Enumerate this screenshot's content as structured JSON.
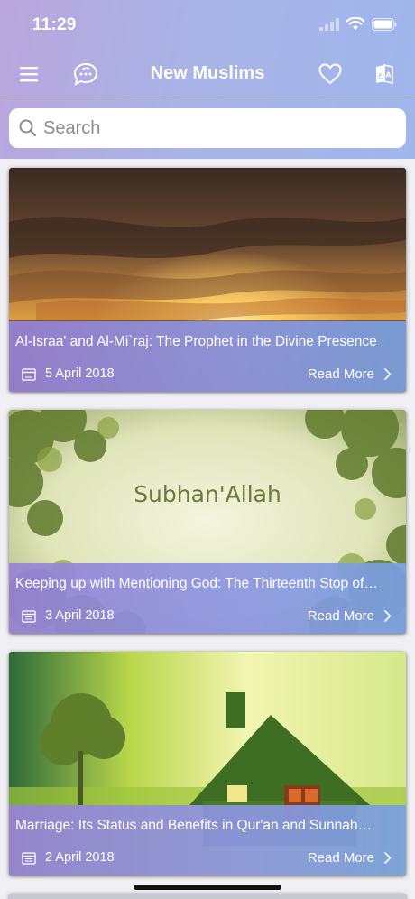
{
  "status_bar": {
    "time": "11:29"
  },
  "nav": {
    "title": "New Muslims"
  },
  "search": {
    "placeholder": "Search"
  },
  "articles": [
    {
      "title": "Al-Israa' and Al-Mi`raj: The Prophet in the Divine Presence",
      "date": "5 April 2018",
      "read_more": "Read More",
      "image": "sunset-clouds"
    },
    {
      "title": "Keeping up with Mentioning God: The Thirteenth Stop of…",
      "date": "3 April 2018",
      "read_more": "Read More",
      "image": "subhan-allah-trees",
      "image_text": "Subhan'Allah"
    },
    {
      "title": "Marriage: Its Status and Benefits in Qur'an and Sunnah…",
      "date": "2 April 2018",
      "read_more": "Read More",
      "image": "grass-house"
    }
  ],
  "colors": {
    "header_start": "#b9a6dc",
    "header_end": "#9fb6ec",
    "overlay": "#8c96e1"
  }
}
